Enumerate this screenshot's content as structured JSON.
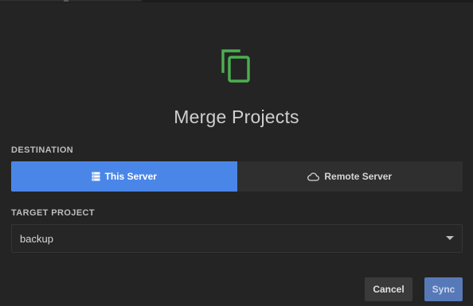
{
  "dialog": {
    "title": "Merge Projects",
    "icon": "copy-icon",
    "accent_color": "#4caf50"
  },
  "destination": {
    "label": "DESTINATION",
    "options": [
      {
        "label": "This Server",
        "icon": "server-icon",
        "selected": true
      },
      {
        "label": "Remote Server",
        "icon": "cloud-icon",
        "selected": false
      }
    ],
    "active_color": "#4a86e8"
  },
  "target_project": {
    "label": "TARGET PROJECT",
    "value": "backup"
  },
  "actions": {
    "cancel_label": "Cancel",
    "sync_label": "Sync"
  }
}
